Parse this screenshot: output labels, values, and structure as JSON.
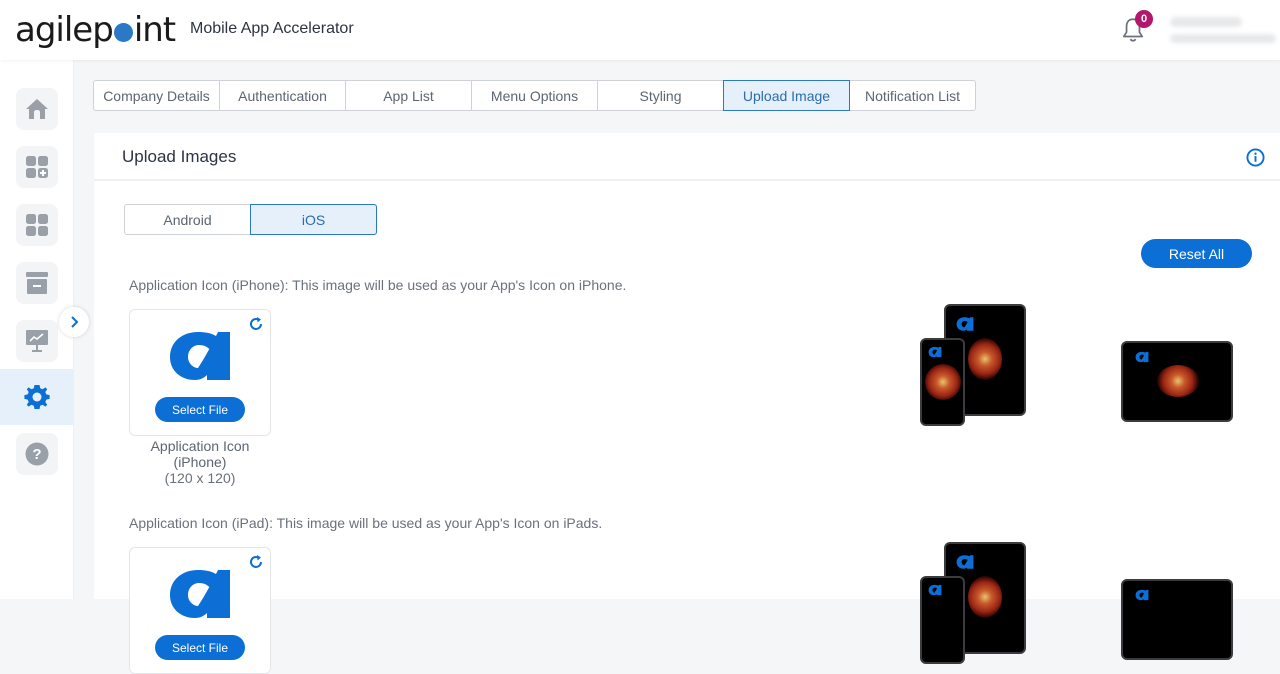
{
  "header": {
    "logo_text_left": "agilep",
    "logo_text_right": "int",
    "app_title": "Mobile App Accelerator",
    "notification_count": "0",
    "brand_color": "#2b78c5",
    "badge_color": "#b3176d"
  },
  "sidebar": {
    "items": [
      {
        "name": "home",
        "icon": "home-icon",
        "active": false
      },
      {
        "name": "add-app",
        "icon": "grid-plus-icon",
        "active": false
      },
      {
        "name": "apps",
        "icon": "grid-icon",
        "active": false
      },
      {
        "name": "archive",
        "icon": "archive-icon",
        "active": false
      },
      {
        "name": "analytics",
        "icon": "presentation-chart-icon",
        "active": false
      },
      {
        "name": "settings",
        "icon": "gear-icon",
        "active": true
      },
      {
        "name": "help",
        "icon": "help-icon",
        "active": false
      }
    ],
    "expand_icon": "chevron-right-icon"
  },
  "tabs": [
    {
      "label": "Company Details",
      "active": false
    },
    {
      "label": "Authentication",
      "active": false
    },
    {
      "label": "App List",
      "active": false
    },
    {
      "label": "Menu Options",
      "active": false
    },
    {
      "label": "Styling",
      "active": false
    },
    {
      "label": "Upload Image",
      "active": true
    },
    {
      "label": "Notification List",
      "active": false
    }
  ],
  "panel": {
    "title": "Upload Images",
    "platforms": [
      {
        "label": "Android",
        "active": false
      },
      {
        "label": "iOS",
        "active": true
      }
    ],
    "reset_label": "Reset All",
    "sections": [
      {
        "description": "Application Icon (iPhone): This image will be used as your App's Icon on iPhone.",
        "select_label": "Select File",
        "caption_line1": "Application Icon",
        "caption_line2": "(iPhone)",
        "size": "(120 x 120)"
      },
      {
        "description": "Application Icon (iPad): This image will be used as your App's Icon on iPads.",
        "select_label": "Select File"
      }
    ]
  }
}
